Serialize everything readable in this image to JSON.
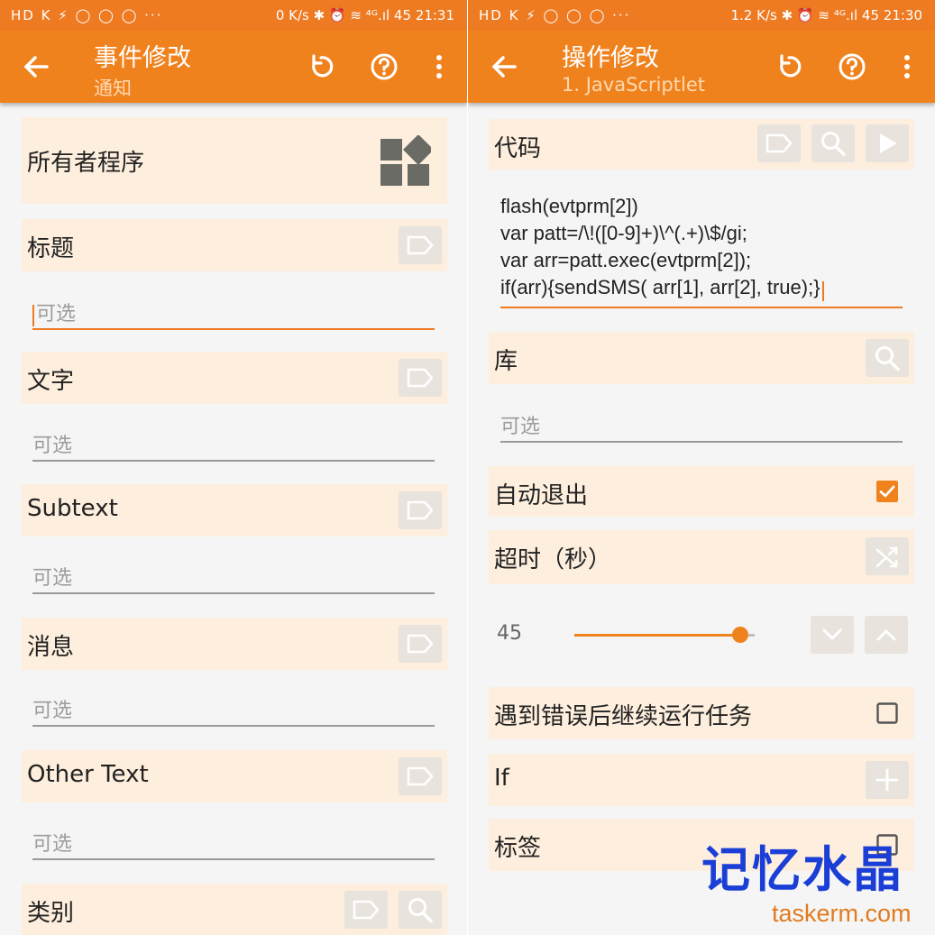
{
  "left": {
    "status": {
      "left": "HD K ⚡ ◯ ◯ ◯ ···",
      "right": "0 K/s ✱ ⏰ ≋ ⁴ᴳ.ıl 45 21:31"
    },
    "appbar": {
      "title": "事件修改",
      "subtitle": "通知"
    },
    "owner_label": "所有者程序",
    "title_label": "标题",
    "title_placeholder": "可选",
    "text_label": "文字",
    "text_placeholder": "可选",
    "subtext_label": "Subtext",
    "subtext_placeholder": "可选",
    "message_label": "消息",
    "message_placeholder": "可选",
    "other_label": "Other Text",
    "other_placeholder": "可选",
    "category_label": "类别"
  },
  "right": {
    "status": {
      "left": "HD K ⚡ ◯ ◯ ◯ ···",
      "right": "1.2 K/s ✱ ⏰ ≋ ⁴ᴳ.ıl 45 21:30"
    },
    "appbar": {
      "title": "操作修改",
      "subtitle": "1. JavaScriptlet"
    },
    "code_label": "代码",
    "code_lines": [
      "flash(evtprm[2])",
      "var patt=/\\!([0-9]+)\\^(.+)\\$/gi;",
      "var arr=patt.exec(evtprm[2]);",
      "if(arr){sendSMS( arr[1], arr[2], true);}"
    ],
    "library_label": "库",
    "library_placeholder": "可选",
    "auto_exit_label": "自动退出",
    "auto_exit_checked": true,
    "timeout_label": "超时（秒）",
    "timeout_value": "45",
    "timeout_fraction": 0.92,
    "continue_label": "遇到错误后继续运行任务",
    "continue_checked": false,
    "if_label": "If",
    "tag_label": "标签"
  },
  "watermark": {
    "chinese": "记忆水晶",
    "site": "taskerm.com"
  },
  "colors": {
    "accent": "#f0821e",
    "section_bg": "#fdeedd",
    "button_bg": "#e8e3dd",
    "watermark_blue": "#1b3fd6"
  }
}
